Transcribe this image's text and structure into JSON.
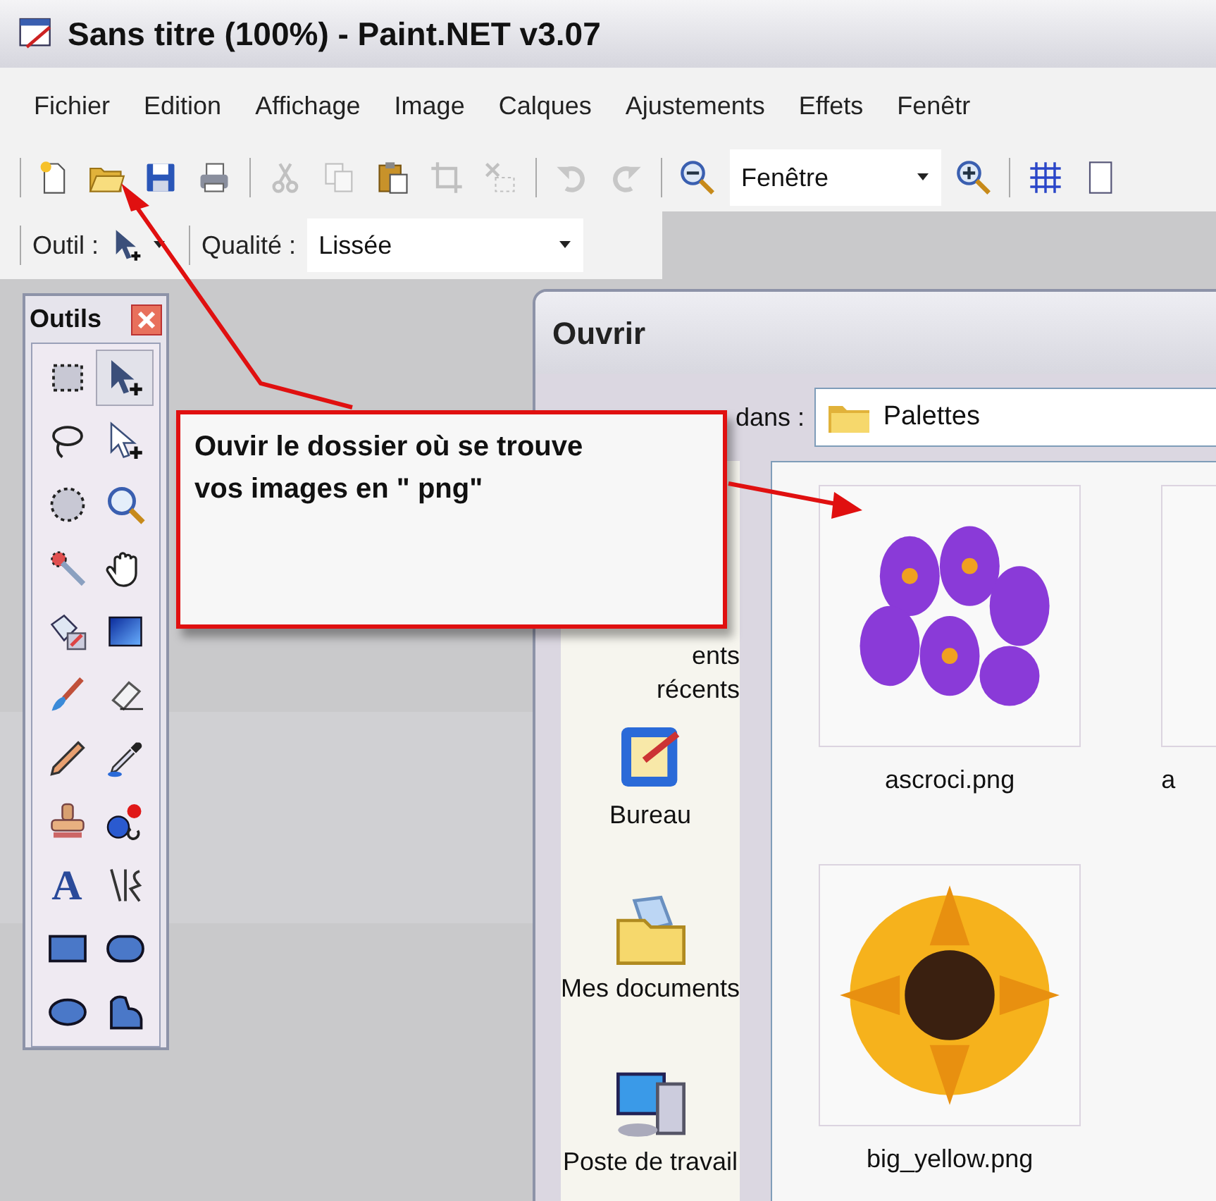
{
  "window": {
    "title": "Sans titre (100%) - Paint.NET v3.07"
  },
  "menu": [
    "Fichier",
    "Edition",
    "Affichage",
    "Image",
    "Calques",
    "Ajustements",
    "Effets",
    "Fenêtr"
  ],
  "toolbar": [
    {
      "kind": "new",
      "disabled": false
    },
    {
      "kind": "open",
      "disabled": false
    },
    {
      "kind": "save",
      "disabled": false
    },
    {
      "kind": "print",
      "disabled": false
    },
    {
      "kind": "separator"
    },
    {
      "kind": "cut",
      "disabled": true
    },
    {
      "kind": "copy",
      "disabled": true
    },
    {
      "kind": "paste",
      "disabled": false
    },
    {
      "kind": "crop",
      "disabled": true
    },
    {
      "kind": "deselect",
      "disabled": true
    },
    {
      "kind": "separator"
    },
    {
      "kind": "undo",
      "disabled": true
    },
    {
      "kind": "redo",
      "disabled": true
    },
    {
      "kind": "separator"
    },
    {
      "kind": "zoom-out",
      "disabled": false
    },
    {
      "kind": "combo",
      "value": "Fenêtre"
    },
    {
      "kind": "zoom-in",
      "disabled": false
    },
    {
      "kind": "separator"
    },
    {
      "kind": "grid",
      "disabled": false
    },
    {
      "kind": "ruler",
      "disabled": false
    }
  ],
  "tool_options": {
    "tool_label": "Outil :",
    "quality_label": "Qualité :",
    "quality": "Lissée"
  },
  "tools_window": {
    "title": "Outils",
    "tools": [
      {
        "kind": "rect-select",
        "selected": false
      },
      {
        "kind": "move-pixels",
        "selected": true
      },
      {
        "kind": "lasso",
        "selected": false
      },
      {
        "kind": "move-selection",
        "selected": false
      },
      {
        "kind": "ellipse-select",
        "selected": false
      },
      {
        "kind": "zoom",
        "selected": false
      },
      {
        "kind": "magic-wand",
        "selected": false
      },
      {
        "kind": "pan",
        "selected": false
      },
      {
        "kind": "bucket",
        "selected": false
      },
      {
        "kind": "gradient",
        "selected": false
      },
      {
        "kind": "brush",
        "selected": false
      },
      {
        "kind": "eraser",
        "selected": false
      },
      {
        "kind": "pencil",
        "selected": false
      },
      {
        "kind": "picker",
        "selected": false
      },
      {
        "kind": "stamp",
        "selected": false
      },
      {
        "kind": "recolor",
        "selected": false
      },
      {
        "kind": "text",
        "glyph": "A",
        "selected": false
      },
      {
        "kind": "line",
        "selected": false
      },
      {
        "kind": "rectangle",
        "selected": false
      },
      {
        "kind": "rounded-rect",
        "selected": false
      },
      {
        "kind": "ellipse",
        "selected": false
      },
      {
        "kind": "freeform",
        "selected": false
      }
    ]
  },
  "open_dialog": {
    "title": "Ouvrir",
    "look_in_label": "dans :",
    "look_in": "Palettes",
    "places": [
      {
        "kind": "recent",
        "label": "ents récents"
      },
      {
        "kind": "desktop",
        "label": "Bureau"
      },
      {
        "kind": "documents",
        "label": "Mes documents"
      },
      {
        "kind": "computer",
        "label": "Poste de travail"
      }
    ],
    "files": [
      {
        "kind": "crocus",
        "name": "ascroci.png"
      },
      {
        "kind": "blank",
        "name": "a"
      },
      {
        "kind": "sunflower",
        "name": "big_yellow.png"
      }
    ]
  },
  "callout": {
    "text": "Ouvir le dossier où se trouve vos images en \" png\""
  }
}
